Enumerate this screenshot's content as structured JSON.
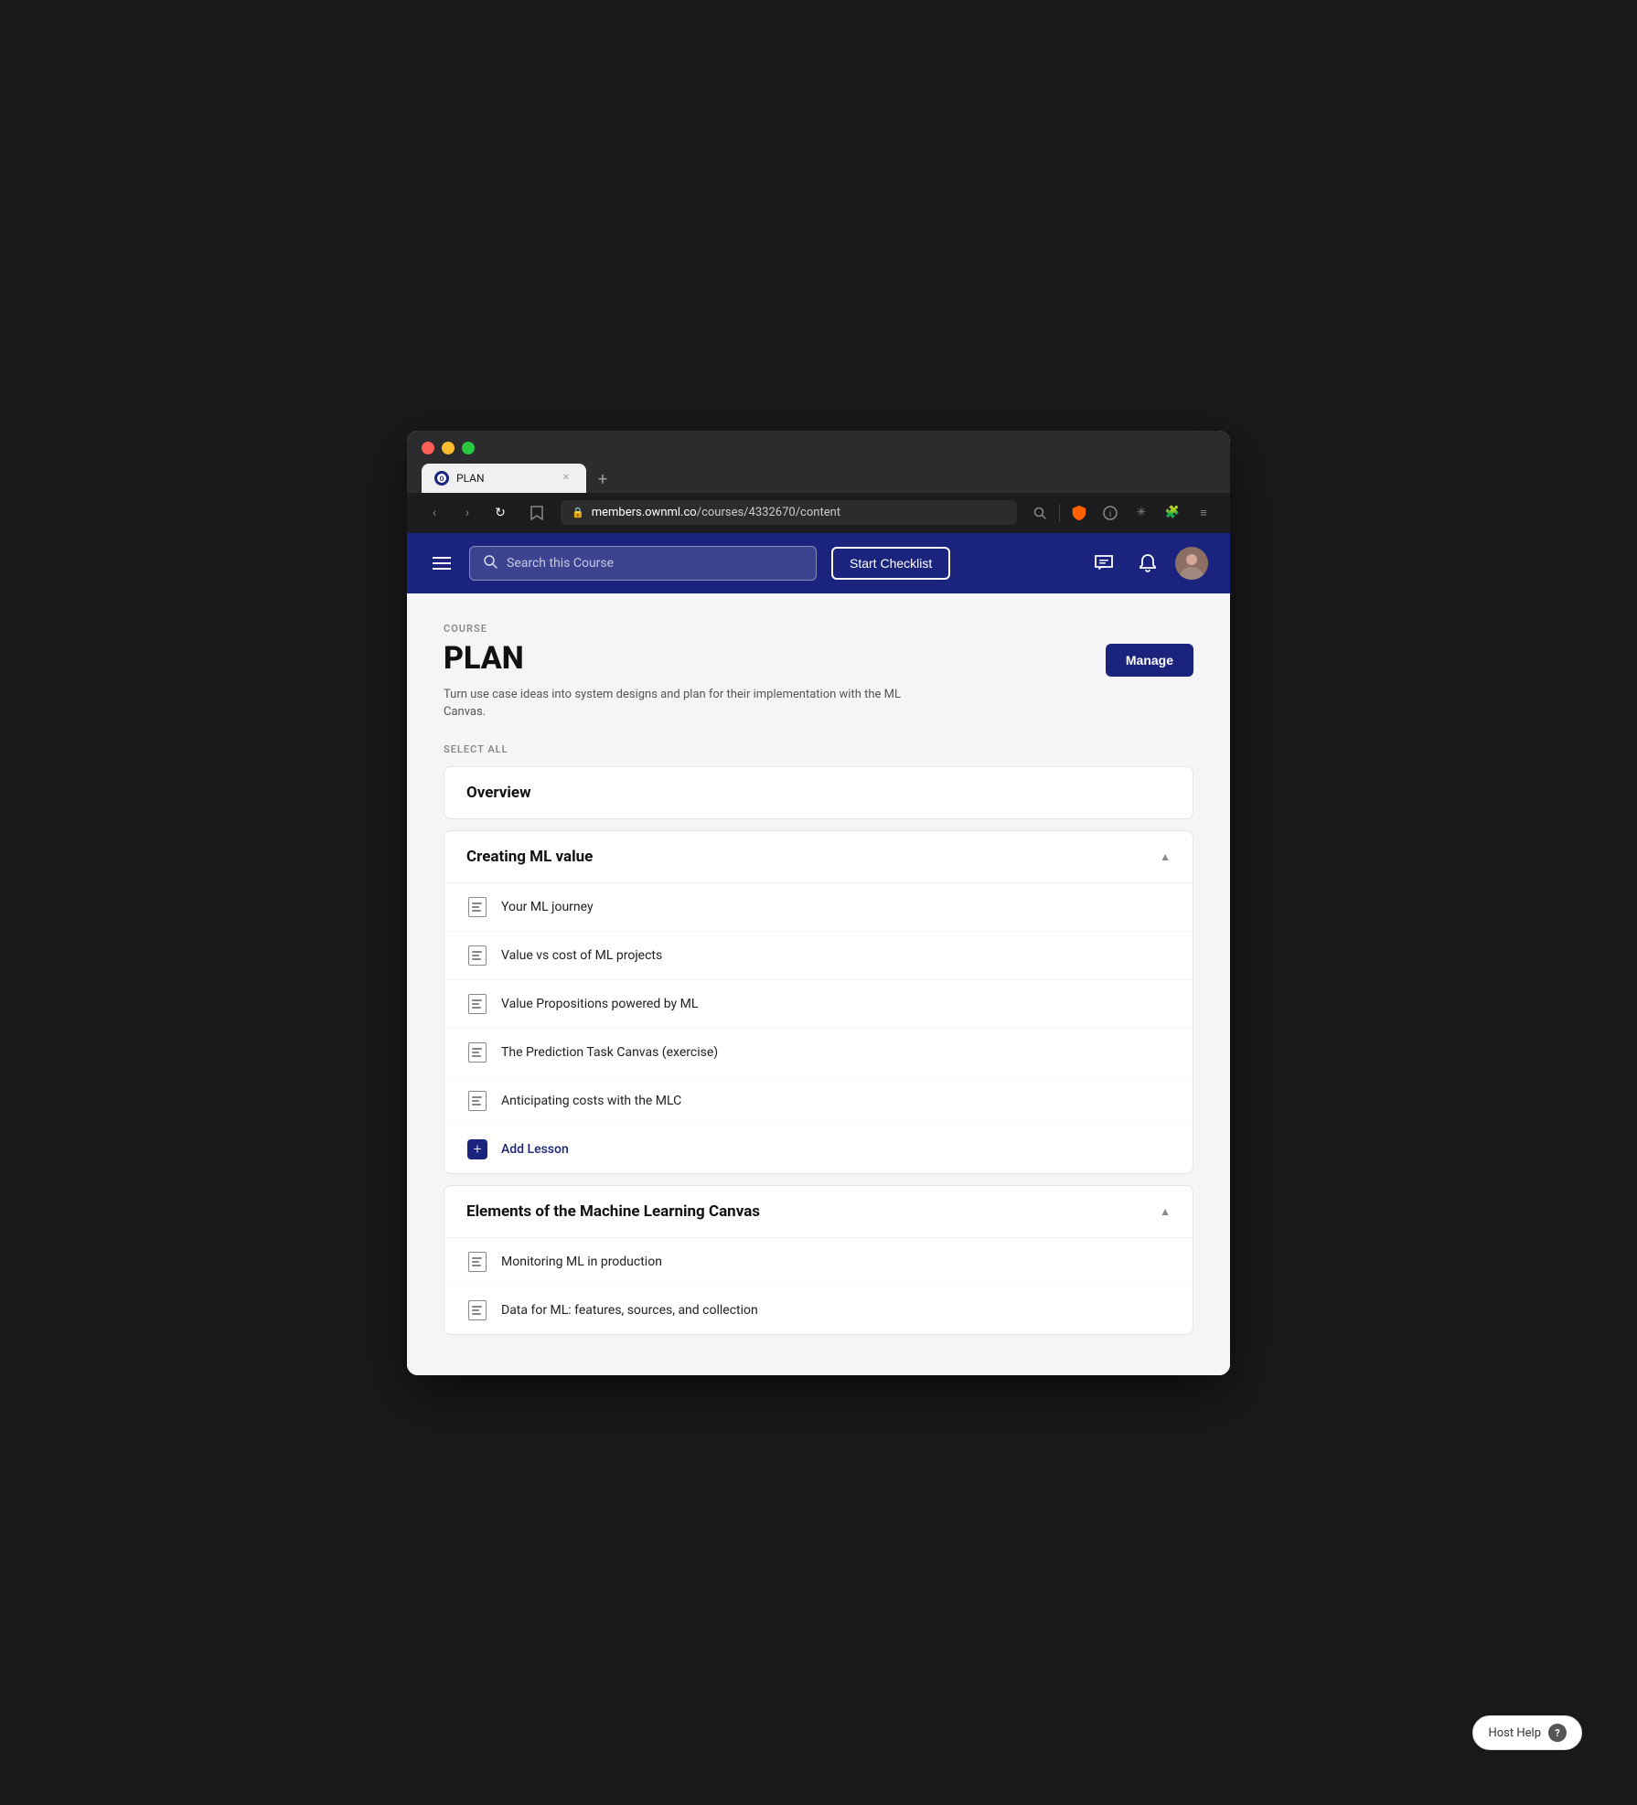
{
  "browser": {
    "tab_title": "PLAN",
    "tab_favicon": "OWN",
    "url_prefix": "members.ownml.co",
    "url_path": "/courses/4332670/content",
    "new_tab_label": "+"
  },
  "nav": {
    "back_label": "‹",
    "forward_label": "›",
    "reload_label": "↺"
  },
  "header": {
    "search_placeholder": "Search this Course",
    "start_checklist_label": "Start Checklist",
    "chat_icon": "💬",
    "bell_icon": "🔔"
  },
  "course": {
    "label": "COURSE",
    "title": "PLAN",
    "description": "Turn use case ideas into system designs and plan for their implementation with the ML Canvas.",
    "manage_label": "Manage"
  },
  "select_all_label": "SELECT ALL",
  "sections": [
    {
      "id": "overview",
      "title": "Overview",
      "collapsible": false,
      "lessons": []
    },
    {
      "id": "creating-ml-value",
      "title": "Creating ML value",
      "collapsible": true,
      "expanded": true,
      "lessons": [
        {
          "title": "Your ML journey",
          "type": "doc"
        },
        {
          "title": "Value vs cost of ML projects",
          "type": "doc"
        },
        {
          "title": "Value Propositions powered by ML",
          "type": "doc"
        },
        {
          "title": "The Prediction Task Canvas (exercise)",
          "type": "doc"
        },
        {
          "title": "Anticipating costs with the MLC",
          "type": "doc"
        },
        {
          "title": "Add Lesson",
          "type": "add"
        }
      ]
    },
    {
      "id": "elements-ml-canvas",
      "title": "Elements of the Machine Learning Canvas",
      "collapsible": true,
      "expanded": true,
      "lessons": [
        {
          "title": "Monitoring ML in production",
          "type": "doc"
        },
        {
          "title": "Data for ML: features, sources, and collection",
          "type": "doc"
        }
      ]
    }
  ],
  "host_help": {
    "label": "Host Help",
    "icon": "?"
  }
}
